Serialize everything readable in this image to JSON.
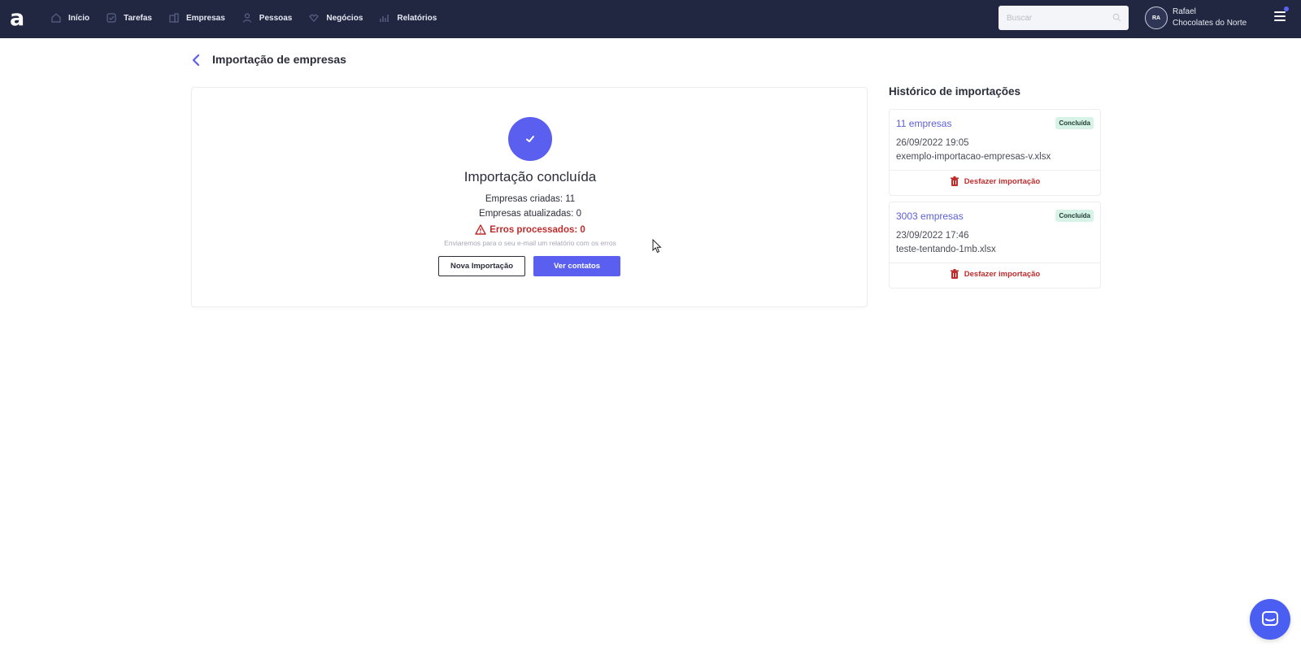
{
  "app": {
    "logo_text": "a"
  },
  "nav": {
    "items": [
      {
        "label": "Início",
        "icon": "home-icon"
      },
      {
        "label": "Tarefas",
        "icon": "tasks-icon"
      },
      {
        "label": "Empresas",
        "icon": "building-icon"
      },
      {
        "label": "Pessoas",
        "icon": "person-icon"
      },
      {
        "label": "Negócios",
        "icon": "deals-icon"
      },
      {
        "label": "Relatórios",
        "icon": "reports-icon"
      }
    ]
  },
  "search": {
    "placeholder": "Buscar"
  },
  "user": {
    "initials": "RA",
    "name": "Rafael",
    "company": "Chocolates do Norte"
  },
  "page": {
    "title": "Importação de empresas"
  },
  "result": {
    "title": "Importação concluída",
    "created": "Empresas criadas: 11",
    "updated": "Empresas atualizadas: 0",
    "errors": "Erros processados: 0",
    "note": "Enviaremos para o seu e-mail um relatório com os erros",
    "new_import_label": "Nova Importação",
    "view_contacts_label": "Ver contatos"
  },
  "history": {
    "title": "Histórico de importações",
    "items": [
      {
        "count": "11 empresas",
        "status": "Concluída",
        "date": "26/09/2022 19:05",
        "file": "exemplo-importacao-empresas-v.xlsx",
        "undo_label": "Desfazer importação"
      },
      {
        "count": "3003 empresas",
        "status": "Concluída",
        "date": "23/09/2022 17:46",
        "file": "teste-tentando-1mb.xlsx",
        "undo_label": "Desfazer importação"
      }
    ]
  },
  "colors": {
    "topbar": "#222741",
    "primary": "#5b5ff0",
    "error": "#c02c2c",
    "badge_bg": "#d7f3e8"
  }
}
